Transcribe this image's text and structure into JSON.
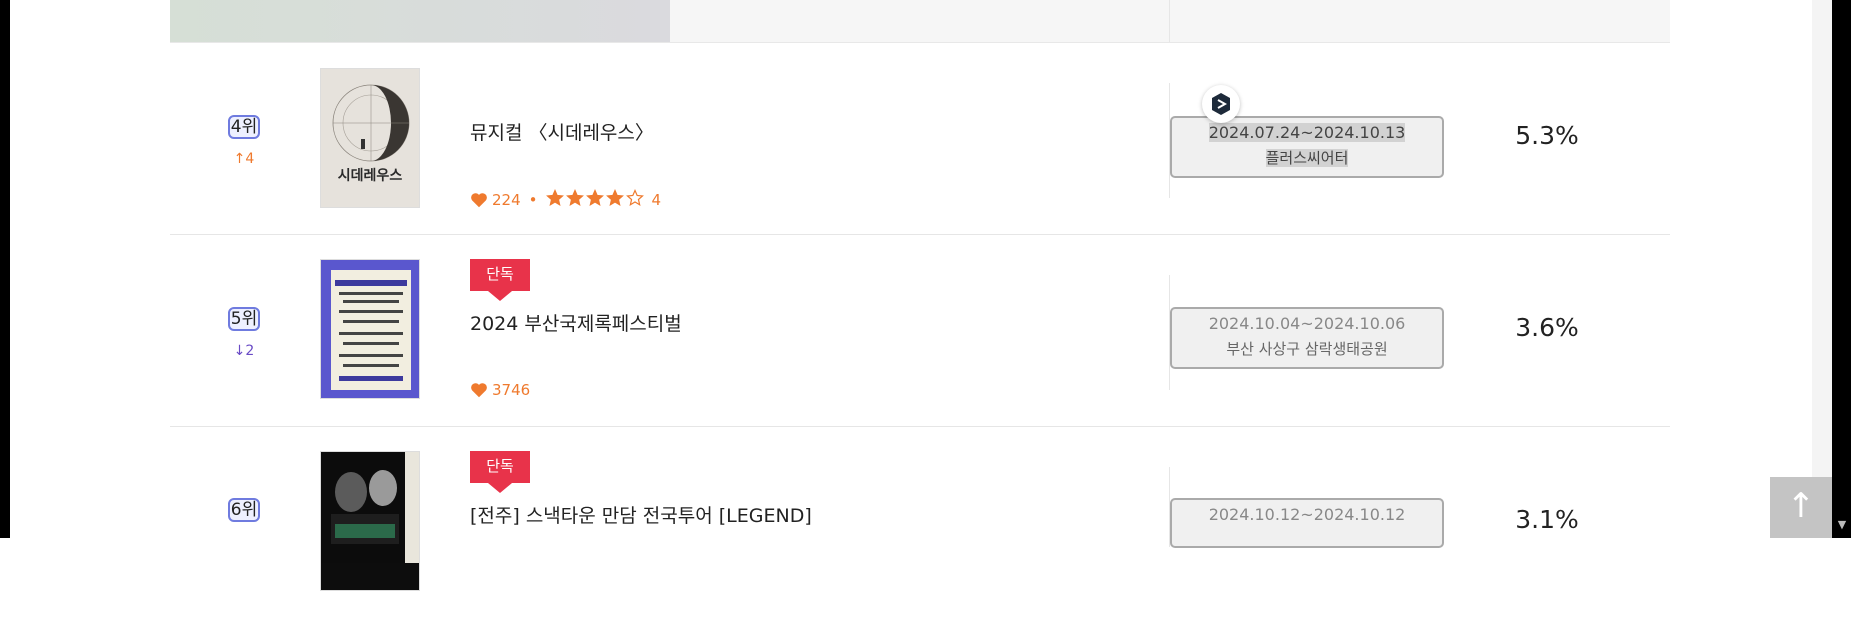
{
  "rows": [
    {
      "rank": "4위",
      "change": "↑4",
      "title": "뮤지컬 〈시데레우스〉",
      "exclusive": "",
      "likes": "224",
      "rating": "4",
      "stars_filled": 4,
      "stars_total": 5,
      "dates": "2024.07.24~2024.10.13",
      "venue": "플러스씨어터",
      "share": "5.3%",
      "poster_text": "시데레우스"
    },
    {
      "rank": "5위",
      "change": "↓2",
      "title": "2024 부산국제록페스티벌",
      "exclusive": "단독",
      "likes": "3746",
      "dates": "2024.10.04~2024.10.06",
      "venue": "부산 사상구 삼락생태공원",
      "share": "3.6%"
    },
    {
      "rank": "6위",
      "title": "[전주] 스낵타운 만담 전국투어 [LEGEND]",
      "exclusive": "단독",
      "dates": "2024.10.12~2024.10.12",
      "share": "3.1%"
    }
  ],
  "top_button": "↑",
  "colors": {
    "accent_orange": "#ef7a2e",
    "exclusive_red": "#e8334a",
    "rank_border": "#6f7bdf",
    "down_purple": "#6a4bc6"
  },
  "icons": [
    "heart-icon",
    "star-icon",
    "star-outline-icon",
    "assistant-badge-icon",
    "arrow-up-icon"
  ]
}
